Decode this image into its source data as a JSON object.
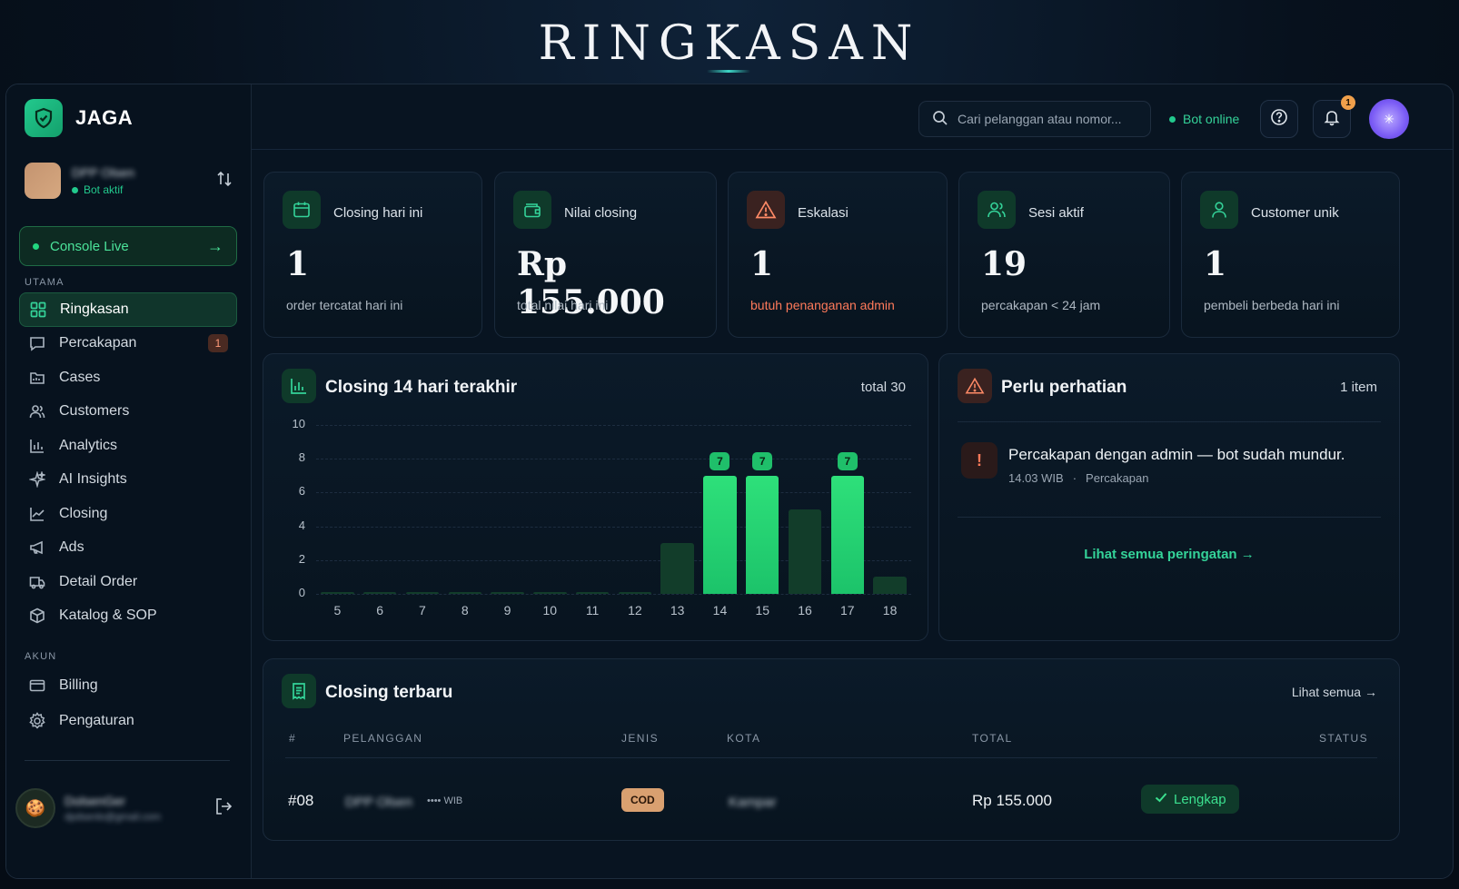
{
  "page": {
    "title": "RINGKASAN"
  },
  "sidebar": {
    "brand": "JAGA",
    "workspace": {
      "name": "DPP Olsen",
      "status": "Bot aktif"
    },
    "console_live": "Console Live",
    "section_main": "UTAMA",
    "items": [
      {
        "label": "Ringkasan",
        "icon": "grid-icon",
        "active": true
      },
      {
        "label": "Percakapan",
        "icon": "chat-icon",
        "badge": "1"
      },
      {
        "label": "Cases",
        "icon": "folder-icon"
      },
      {
        "label": "Customers",
        "icon": "users-icon"
      },
      {
        "label": "Analytics",
        "icon": "bar-chart-icon"
      },
      {
        "label": "AI Insights",
        "icon": "sparkles-icon"
      },
      {
        "label": "Closing",
        "icon": "line-chart-icon"
      },
      {
        "label": "Ads",
        "icon": "megaphone-icon"
      },
      {
        "label": "Detail Order",
        "icon": "truck-icon"
      },
      {
        "label": "Katalog & SOP",
        "icon": "box-icon"
      }
    ],
    "section_account": "AKUN",
    "account_items": [
      {
        "label": "Billing",
        "icon": "card-icon"
      },
      {
        "label": "Pengaturan",
        "icon": "gear-icon"
      }
    ],
    "user": {
      "name": "DolsenGer",
      "email": "dpdsenlo@gmail.com"
    }
  },
  "topbar": {
    "search_placeholder": "Cari pelanggan atau nomor...",
    "bot_status": "Bot online",
    "notification_count": "1"
  },
  "stats": [
    {
      "icon": "calendar-icon",
      "label": "Closing hari ini",
      "value": "1",
      "sub": "order tercatat hari ini",
      "tone": "green"
    },
    {
      "icon": "wallet-icon",
      "label": "Nilai closing",
      "value": "Rp 155.000",
      "sub": "total nilai hari ini",
      "tone": "green"
    },
    {
      "icon": "warning-icon",
      "label": "Eskalasi",
      "value": "1",
      "sub": "butuh penanganan admin",
      "tone": "orange"
    },
    {
      "icon": "users-icon",
      "label": "Sesi aktif",
      "value": "19",
      "sub": "percakapan < 24 jam",
      "tone": "green"
    },
    {
      "icon": "user-icon",
      "label": "Customer unik",
      "value": "1",
      "sub": "pembeli berbeda hari ini",
      "tone": "green"
    }
  ],
  "chart_panel": {
    "title": "Closing 14 hari terakhir",
    "total": "total 30"
  },
  "chart_data": {
    "type": "bar",
    "categories": [
      "5",
      "6",
      "7",
      "8",
      "9",
      "10",
      "11",
      "12",
      "13",
      "14",
      "15",
      "16",
      "17",
      "18"
    ],
    "values": [
      0,
      0,
      0,
      0,
      0,
      0,
      0,
      0,
      3,
      7,
      7,
      5,
      7,
      1
    ],
    "highlight": [
      false,
      false,
      false,
      false,
      false,
      false,
      false,
      false,
      false,
      true,
      true,
      false,
      true,
      false
    ],
    "data_labels": [
      "",
      "",
      "",
      "",
      "",
      "",
      "",
      "",
      "",
      "7",
      "7",
      "",
      "7",
      ""
    ],
    "yticks": [
      "0",
      "2",
      "4",
      "6",
      "8",
      "10"
    ],
    "ylim": [
      0,
      10
    ],
    "grid": true,
    "colors": {
      "highlight": "#22d67a",
      "muted": "#123d2a"
    }
  },
  "alerts": {
    "title": "Perlu perhatian",
    "count": "1 item",
    "items": [
      {
        "text": "Percakapan dengan admin — bot sudah mundur.",
        "time": "14.03 WIB",
        "source": "Percakapan"
      }
    ],
    "see_all": "Lihat semua peringatan"
  },
  "recent": {
    "title": "Closing terbaru",
    "see_all": "Lihat semua",
    "columns": [
      "#",
      "PELANGGAN",
      "JENIS",
      "KOTA",
      "TOTAL",
      "STATUS"
    ],
    "rows": [
      {
        "id": "#08",
        "customer": "DPP Olsen",
        "time": "WIB",
        "type": "COD",
        "city": "Kampar",
        "total": "Rp 155.000",
        "status": "Lengkap"
      }
    ]
  }
}
